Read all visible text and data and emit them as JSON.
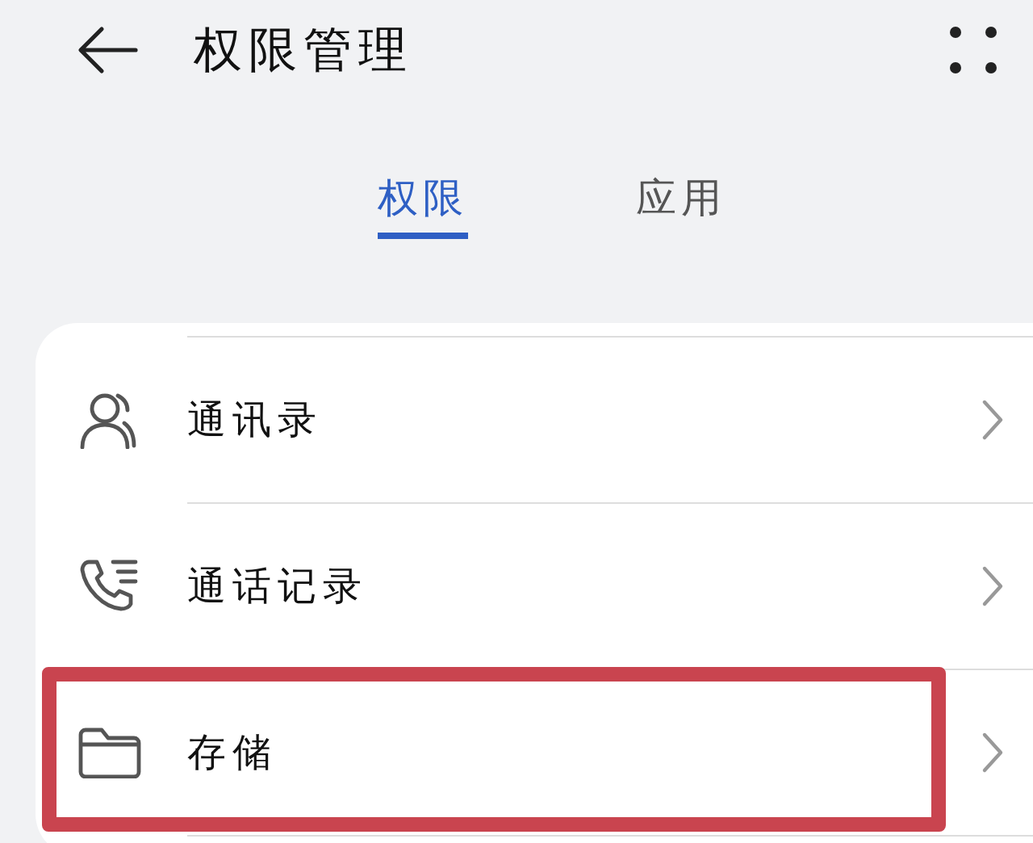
{
  "header": {
    "title": "权限管理"
  },
  "tabs": [
    {
      "label": "权限",
      "selected": true
    },
    {
      "label": "应用",
      "selected": false
    }
  ],
  "permissions": [
    {
      "label": "通讯录",
      "highlighted": false
    },
    {
      "label": "通话记录",
      "highlighted": false
    },
    {
      "label": "存储",
      "highlighted": true
    }
  ]
}
